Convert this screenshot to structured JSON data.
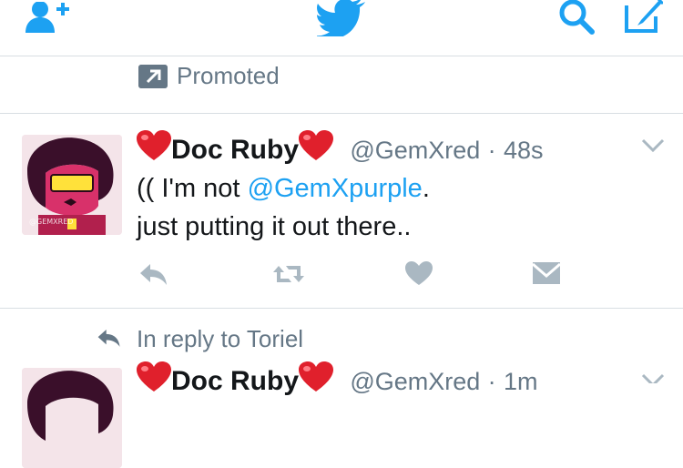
{
  "promoted": {
    "label": "Promoted"
  },
  "tweet1": {
    "display_name": "Doc Ruby",
    "handle": "@GemXred",
    "separator": "·",
    "time": "48s",
    "text_prefix": "(( I'm not ",
    "mention": "@GemXpurple",
    "text_line1_end": ".",
    "text_line2": "just putting it out there..",
    "avatar_watermark": "@GEMXRED"
  },
  "reply_context": {
    "label": "In reply to Toriel"
  },
  "tweet2": {
    "display_name": "Doc Ruby",
    "handle": "@GemXred",
    "separator": "·",
    "time": "1m"
  },
  "colors": {
    "brand_blue": "#1da1f2",
    "secondary_text": "#657786",
    "action_gray": "#aab8c2",
    "divider": "#d8dee3",
    "heart_red": "#e0202c"
  },
  "icons": {
    "nav": [
      "add-user-icon",
      "twitter-bird-icon",
      "search-icon",
      "compose-icon"
    ],
    "actions": [
      "reply-icon",
      "retweet-icon",
      "like-icon",
      "direct-message-icon"
    ]
  }
}
